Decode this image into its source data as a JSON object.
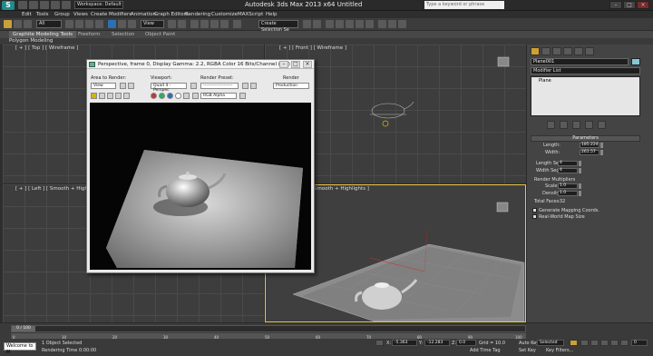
{
  "window": {
    "title": "Autodesk 3ds Max  2013 x64      Untitled",
    "workspace": "Workspace: Default",
    "search_placeholder": "Type a keyword or phrase"
  },
  "menu": [
    "Edit",
    "Tools",
    "Group",
    "Views",
    "Create",
    "Modifiers",
    "Animation",
    "Graph Editors",
    "Rendering",
    "Customize",
    "MAXScript",
    "Help"
  ],
  "toolbar": {
    "filter_value": "All",
    "refcoord_value": "View",
    "selset_placeholder": "Create Selection Se"
  },
  "ribbon": {
    "tabs": [
      "Graphite Modeling Tools",
      "Freeform",
      "Selection",
      "Object Paint"
    ],
    "subtab": "Polygon Modeling"
  },
  "viewports": {
    "top_label": "[ + ] [ Top ] [ Wireframe ]",
    "front_label": "[ + ] [ Front ] [ Wireframe ]",
    "left_label": "[ + ] [ Left ] [ Smooth + Highlights ]",
    "persp_label": "Smooth + Highlights ]"
  },
  "render_window": {
    "title": "Perspective, frame 0, Display Gamma: 2.2, RGBA Color 16 Bits/Channel (1:1)",
    "area_label": "Area to Render:",
    "area_value": "View",
    "viewport_label": "Viewport:",
    "viewport_value": "Quad 4 - Perspec",
    "preset_label": "Render Preset:",
    "preset_value": "--------------------",
    "render_label": "Render",
    "render_value": "Production",
    "channel_value": "RGB Alpha"
  },
  "command_panel": {
    "object_name": "Plane001",
    "modifier_list": "Modifier List",
    "stack_item": "Plane",
    "parameters_header": "Parameters",
    "length_label": "Length:",
    "length_value": "185.224",
    "width_label": "Width:",
    "width_value": "261.57",
    "length_segs_label": "Length Segs:",
    "length_segs_value": "4",
    "width_segs_label": "Width Segs:",
    "width_segs_value": "4",
    "render_multipliers_label": "Render Multipliers",
    "scale_label": "Scale:",
    "scale_value": "1.0",
    "density_label": "Density:",
    "density_value": "1.0",
    "total_faces_label": "Total Faces:",
    "total_faces_value": "32",
    "gen_mapping_label": "Generate Mapping Coords.",
    "real_world_label": "Real-World Map Size"
  },
  "status": {
    "time_slider": "0 / 100",
    "listener": "Welcome to M",
    "selected": "1 Object Selected",
    "rendering_time": "Rendering Time  0:00:00",
    "x_value": "-5.363",
    "y_value": "-12.283",
    "z_value": "0.0",
    "grid": "Grid = 10.0",
    "auto_key": "Auto Key",
    "auto_key_value": "Selected",
    "set_key": "Set Key",
    "key_filters": "Key Filters...",
    "add_time_tag": "Add Time Tag",
    "frame": "0",
    "ticks": [
      "0",
      "10",
      "20",
      "30",
      "40",
      "50",
      "60",
      "70",
      "80",
      "90",
      "100"
    ]
  },
  "colors": {
    "accent": "#1f8c8c",
    "viewport_bg": "#3d3d3d",
    "active_border": "#e8c84a"
  }
}
